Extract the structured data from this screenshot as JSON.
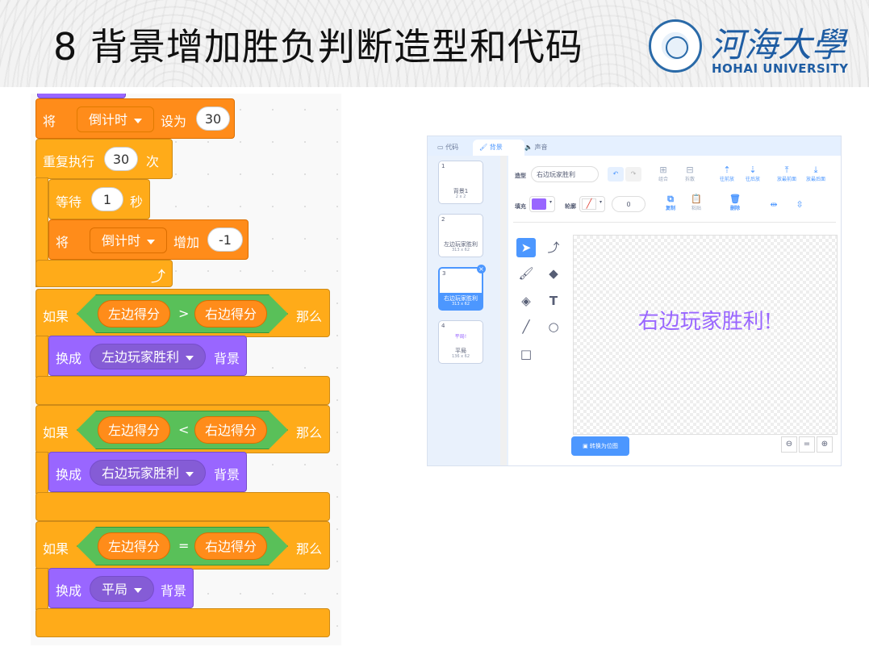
{
  "slide": {
    "title": "8 背景增加胜负判断造型和代码",
    "university_cn": "河海大學",
    "university_en": "HOHAI UNIVERSITY"
  },
  "code": {
    "set_block": {
      "prefix": "将",
      "var": "倒计时",
      "mid": "设为",
      "value": "30"
    },
    "repeat_block": {
      "prefix": "重复执行",
      "value": "30",
      "suffix": "次"
    },
    "wait_block": {
      "prefix": "等待",
      "value": "1",
      "suffix": "秒"
    },
    "change_block": {
      "prefix": "将",
      "var": "倒计时",
      "mid": "增加",
      "value": "-1"
    },
    "loop_arrow": "⤴",
    "if_blocks": [
      {
        "if": "如果",
        "left": "左边得分",
        "op": ">",
        "right": "右边得分",
        "then": "那么",
        "switch": "换成",
        "backdrop": "左边玩家胜利",
        "suffix": "背景"
      },
      {
        "if": "如果",
        "left": "左边得分",
        "op": "<",
        "right": "右边得分",
        "then": "那么",
        "switch": "换成",
        "backdrop": "右边玩家胜利",
        "suffix": "背景"
      },
      {
        "if": "如果",
        "left": "左边得分",
        "op": "=",
        "right": "右边得分",
        "then": "那么",
        "switch": "换成",
        "backdrop": "平局",
        "suffix": "背景"
      }
    ]
  },
  "editor": {
    "tabs": [
      "代码",
      "背景",
      "声音"
    ],
    "active_tab": "背景",
    "costume_label": "造型",
    "costume_name": "右边玩家胜利",
    "fill_label": "填充",
    "fill_color": "#9966ff",
    "outline_label": "轮廓",
    "outline_value": "0",
    "toolbar": [
      "组合",
      "拆散",
      "往前放",
      "往后放",
      "放最前面",
      "放最后面",
      "复制",
      "粘贴",
      "删除"
    ],
    "backdrops": [
      {
        "num": "1",
        "name": "背景1",
        "size": "2 x 2",
        "preview": ""
      },
      {
        "num": "2",
        "name": "左边玩家胜利",
        "size": "313 x 62",
        "preview": ""
      },
      {
        "num": "3",
        "name": "右边玩家胜利",
        "size": "313 x 62",
        "preview": ""
      },
      {
        "num": "4",
        "name": "平局",
        "size": "136 x 62",
        "preview": "平局!"
      }
    ],
    "canvas_text": "右边玩家胜利!",
    "convert_button": "转换为位图",
    "zoom": [
      "⊖",
      "=",
      "⊕"
    ]
  }
}
